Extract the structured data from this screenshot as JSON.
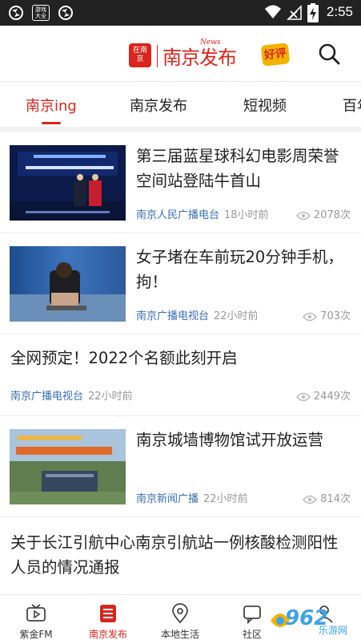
{
  "status_bar": {
    "time": "2:55",
    "icons": [
      "app-icon",
      "game-icon",
      "app-icon",
      "wifi-icon",
      "no-signal-icon",
      "battery-charging-icon"
    ],
    "game_icon_text": "游戏大全"
  },
  "header": {
    "logo_badge_text": "在南京",
    "logo_text": "南京发布",
    "logo_news": "News",
    "promo_text": "好评",
    "search_icon": "search-icon"
  },
  "tabs": [
    {
      "label": "南京ing",
      "active": true
    },
    {
      "label": "南京发布",
      "active": false
    },
    {
      "label": "短视频",
      "active": false
    },
    {
      "label": "百年",
      "active": false
    }
  ],
  "articles": [
    {
      "title": "第三届蓝星球科幻电影周荣誉空间站登陆牛首山",
      "source": "南京人民广播电台",
      "time": "18小时前",
      "views": "2078次",
      "has_image": true
    },
    {
      "title": "女子堵在车前玩20分钟手机，拘！",
      "source": "南京广播电视台",
      "time": "22小时前",
      "views": "703次",
      "has_image": true
    },
    {
      "title": "全网预定！2022个名额此刻开启",
      "source": "南京广播电视台",
      "time": "22小时前",
      "views": "2449次",
      "has_image": false
    },
    {
      "title": "南京城墙博物馆试开放运营",
      "source": "南京新闻广播",
      "time": "22小时前",
      "views": "814次",
      "has_image": true
    },
    {
      "title": "关于长江引航中心南京引航站一例核酸检测阳性人员的情况通报",
      "source": "",
      "time": "",
      "views": "",
      "has_image": false
    }
  ],
  "bottom_nav": [
    {
      "label": "紫金FM",
      "icon": "tv-icon",
      "active": false
    },
    {
      "label": "南京发布",
      "icon": "list-icon",
      "active": true
    },
    {
      "label": "本地生活",
      "icon": "location-pin-icon",
      "active": false
    },
    {
      "label": "社区",
      "icon": "community-icon",
      "active": false
    },
    {
      "label": "",
      "icon": "user-icon",
      "active": false
    }
  ],
  "watermark": {
    "text": "962",
    "sub": "乐游网"
  },
  "colors": {
    "accent": "#d9261c",
    "source_blue": "#3a6fb0",
    "meta_grey": "#999999",
    "status_bar": "#222222"
  }
}
